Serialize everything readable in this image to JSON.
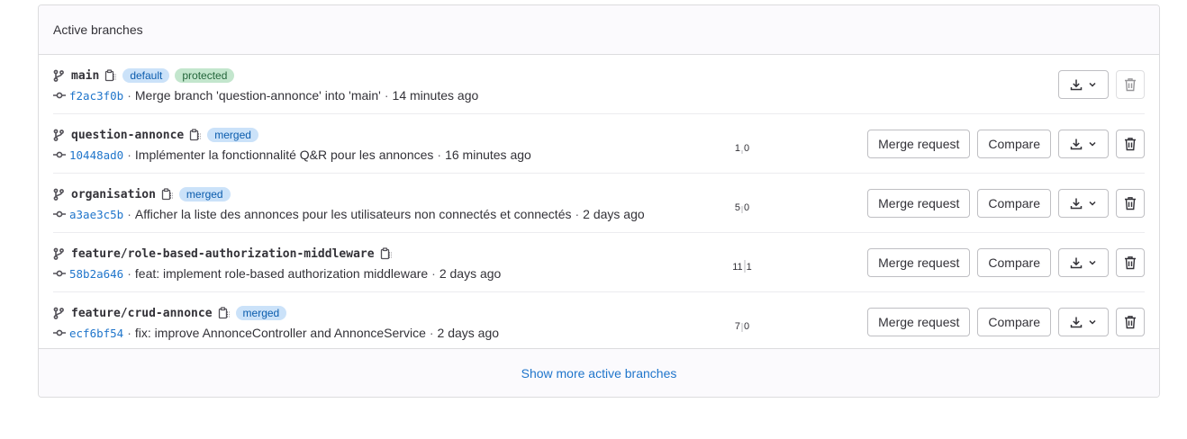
{
  "header": {
    "title": "Active branches"
  },
  "branches": [
    {
      "name": "main",
      "badges": [
        {
          "label": "default",
          "color": "#cbe2f9"
        },
        {
          "label": "protected",
          "color": "#c3e6cd"
        }
      ],
      "sha": "f2ac3f0b",
      "message": "Merge branch 'question-annonce' into 'main'",
      "time": "14 minutes ago",
      "behind": "",
      "ahead": "",
      "show_merge_request": false,
      "show_compare": false
    },
    {
      "name": "question-annonce",
      "badges": [
        {
          "label": "merged",
          "color": "#cbe2f9"
        }
      ],
      "sha": "10448ad0",
      "message": "Implémenter la fonctionnalité Q&R pour les annonces",
      "time": "16 minutes ago",
      "behind": "1",
      "ahead": "0",
      "show_merge_request": true,
      "show_compare": true
    },
    {
      "name": "organisation",
      "badges": [
        {
          "label": "merged",
          "color": "#cbe2f9"
        }
      ],
      "sha": "a3ae3c5b",
      "message": "Afficher la liste des annonces pour les utilisateurs non connectés et connectés",
      "time": "2 days ago",
      "behind": "5",
      "ahead": "0",
      "show_merge_request": true,
      "show_compare": true
    },
    {
      "name": "feature/role-based-authorization-middleware",
      "badges": [],
      "sha": "58b2a646",
      "message": "feat: implement role-based authorization middleware",
      "time": "2 days ago",
      "behind": "11",
      "ahead": "1",
      "show_merge_request": true,
      "show_compare": true
    },
    {
      "name": "feature/crud-annonce",
      "badges": [
        {
          "label": "merged",
          "color": "#cbe2f9"
        }
      ],
      "sha": "ecf6bf54",
      "message": "fix: improve AnnonceController and AnnonceService",
      "time": "2 days ago",
      "behind": "7",
      "ahead": "0",
      "show_merge_request": true,
      "show_compare": true
    }
  ],
  "buttons": {
    "merge_request": "Merge request",
    "compare": "Compare"
  },
  "footer": {
    "show_more": "Show more active branches"
  },
  "icons": {
    "branch": "branch-icon",
    "copy": "copy-to-clipboard-icon",
    "commit": "commit-icon",
    "download": "download-icon",
    "chevron": "chevron-down-icon",
    "delete": "trash-icon"
  },
  "colors": {
    "link": "#1f75cb",
    "border": "#dcdcde",
    "header_bg": "#fbfafd"
  }
}
